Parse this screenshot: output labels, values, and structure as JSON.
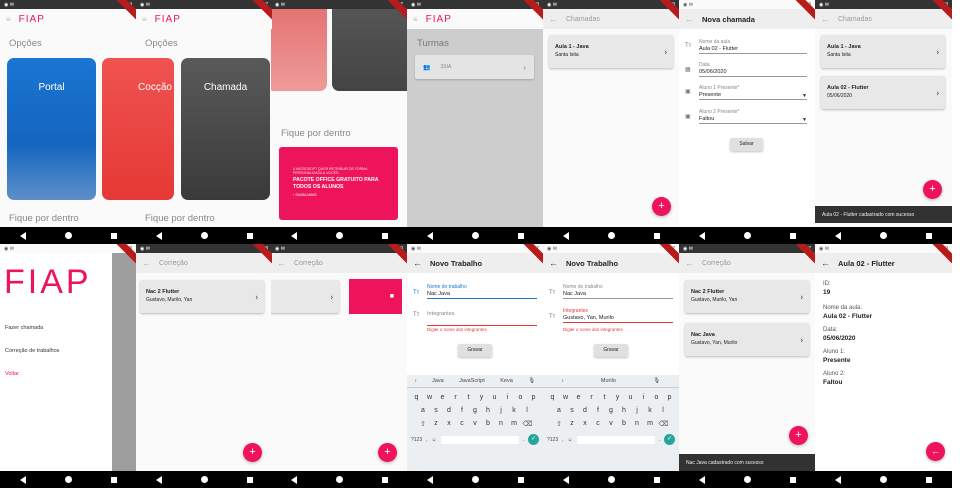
{
  "colors": {
    "brand": "#ed145b",
    "portal_tile": "#1565c0",
    "dark_tile": "#424242"
  },
  "common": {
    "logo": "FIAP",
    "opcoes": "Opções",
    "fique_por_dentro": "Fique por dentro",
    "chamadas": "Chamadas",
    "nova_chamada": "Nova chamada",
    "correcao": "Correção",
    "novo_trabalho": "Novo Trabalho",
    "fab": "+",
    "chevron": "›"
  },
  "status_times": [
    "2:34",
    "6:47",
    "6:47",
    "2:33",
    "2:33",
    "2:33",
    "2:33",
    "2:38",
    "2:38",
    "2:39",
    "2:37",
    "2:37",
    "2:37",
    "2:39"
  ],
  "home": {
    "tiles": {
      "portal": "Portal",
      "coccao": "Cocção",
      "chamada": "Chamada"
    },
    "turmas": "Turmas",
    "turma_item": "3SIA",
    "promo": {
      "small": "A MICROSOFT QUER RETRIBUIR DE FORMA PERSONALIZADA A VOCÊS: ",
      "headline": "PACOTE OFFICE GRATUITO PARA TODOS OS ALUNOS",
      "cta": "› SAIBA MAIS"
    }
  },
  "chamadas": {
    "aula1": {
      "title": "Aula 1 - Java",
      "sub": "Santa Isita"
    },
    "aula2": {
      "title": "Aula 02 - Flutter",
      "sub": "05/06/2020"
    },
    "snackbar": "Aula 02 - Flutter cadastrado com sucesso"
  },
  "nova_chamada": {
    "nome_label": "Nome da aula",
    "nome_value": "Aula 02 - Flutter",
    "data_label": "Data",
    "data_value": "05/06/2020",
    "aluno1_label": "Aluno 1 Presente*",
    "aluno1_value": "Presente",
    "aluno2_label": "Aluno 2 Presente*",
    "aluno2_value": "Faltou",
    "salvar": "Salvar"
  },
  "drawer": {
    "items": [
      "Fazer chamada",
      "Correção de trabalhos"
    ],
    "voltar": "Voltar"
  },
  "correcao": {
    "item1": {
      "title": "Nac 2 Flutter",
      "sub": "Gustavo, Murilo, Yan"
    },
    "item2": {
      "title": "Nac Java",
      "sub": "Gustavo, Yan, Murilo"
    },
    "snackbar": "Nac Java cadastrado com sucesso"
  },
  "novo_trabalho": {
    "nome_label": "Nome do trabalho",
    "nome_value": "Nac Java",
    "int_label": "Integrantes",
    "int_placeholder": "Integrantes",
    "int_value": "Gustavo, Yan, Murilo",
    "error": "Digite o nome dos integrantes",
    "gravar": "Gravar"
  },
  "keyboard1": {
    "suggestions": [
      "Java",
      "JavaScript",
      "Keva"
    ],
    "row1": [
      "q",
      "w",
      "e",
      "r",
      "t",
      "y",
      "u",
      "i",
      "o",
      "p"
    ],
    "row2": [
      "a",
      "s",
      "d",
      "f",
      "g",
      "h",
      "j",
      "k",
      "l"
    ],
    "row3": [
      "z",
      "x",
      "c",
      "v",
      "b",
      "n",
      "m"
    ],
    "bottom": "?123"
  },
  "keyboard2": {
    "suggestions": [
      "Murilo"
    ]
  },
  "detalhe": {
    "title": "Aula 02 - Flutter",
    "id_label": "ID:",
    "id_value": "19",
    "nome_label": "Nome da aula:",
    "nome_value": "Aula 02 - Flutter",
    "data_label": "Data:",
    "data_value": "05/06/2020",
    "a1_label": "Aluno 1:",
    "a1_value": "Presente",
    "a2_label": "Aluno 2:",
    "a2_value": "Faltou",
    "back_fab": "←"
  }
}
